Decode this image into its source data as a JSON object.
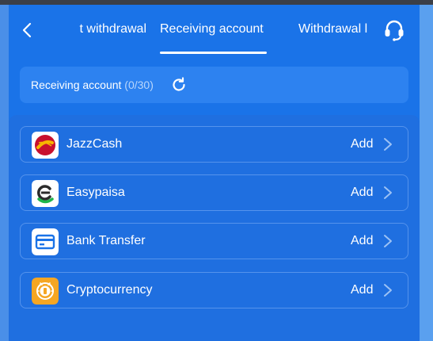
{
  "header": {
    "tabs": [
      {
        "label": "t withdrawal"
      },
      {
        "label": "Receiving account"
      },
      {
        "label": "Withdrawal l"
      }
    ],
    "active_tab": 1
  },
  "summary": {
    "label": "Receiving account",
    "count": "(0/30)"
  },
  "accounts": [
    {
      "name": "JazzCash",
      "action": "Add",
      "icon": "jazzcash-logo"
    },
    {
      "name": "Easypaisa",
      "action": "Add",
      "icon": "easypaisa-logo"
    },
    {
      "name": "Bank Transfer",
      "action": "Add",
      "icon": "card-icon"
    },
    {
      "name": "Cryptocurrency",
      "action": "Add",
      "icon": "coin-icon"
    }
  ],
  "colors": {
    "background": "#1a73e8",
    "panel": "#1f6fe0",
    "card_accent": "#1a73e8",
    "crypto_orange": "#f5a623"
  }
}
